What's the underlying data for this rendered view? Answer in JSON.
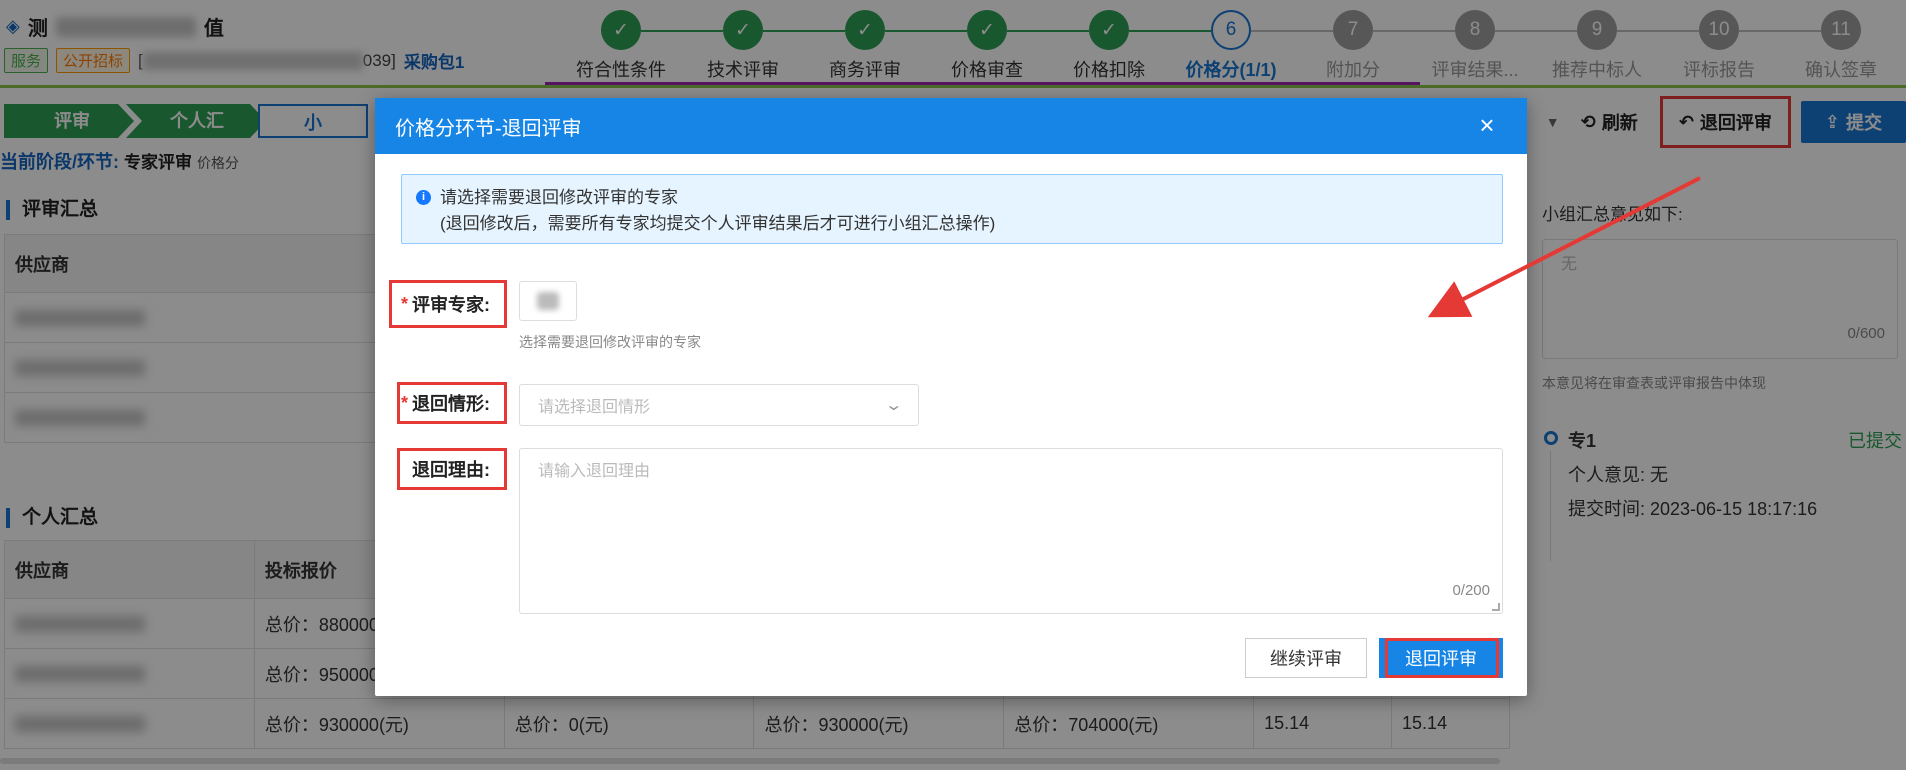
{
  "header": {
    "project_title_prefix": "测",
    "project_title_suffix": "值",
    "tag_service": "服务",
    "tag_method": "公开招标",
    "code_prefix": "[",
    "code_suffix": "039]",
    "package": "采购包1"
  },
  "steps": [
    {
      "num": "✓",
      "label": "符合性条件",
      "state": "done"
    },
    {
      "num": "✓",
      "label": "技术评审",
      "state": "done"
    },
    {
      "num": "✓",
      "label": "商务评审",
      "state": "done"
    },
    {
      "num": "✓",
      "label": "价格审查",
      "state": "done"
    },
    {
      "num": "✓",
      "label": "价格扣除",
      "state": "done"
    },
    {
      "num": "6",
      "label": "价格分(1/1)",
      "state": "current"
    },
    {
      "num": "7",
      "label": "附加分",
      "state": "todo"
    },
    {
      "num": "8",
      "label": "评审结果...",
      "state": "todo"
    },
    {
      "num": "9",
      "label": "推荐中标人",
      "state": "todo"
    },
    {
      "num": "10",
      "label": "评标报告",
      "state": "todo"
    },
    {
      "num": "11",
      "label": "确认签章",
      "state": "todo"
    }
  ],
  "breadcrumb": [
    "评审",
    "个人汇总",
    "小"
  ],
  "stage": {
    "label": "当前阶段/环节:",
    "value": "专家评审",
    "sub": "价格分"
  },
  "sections": {
    "summary": "评审汇总",
    "personal": "个人汇总"
  },
  "summary_table": {
    "header": "供应商"
  },
  "personal_table": {
    "headers": [
      "供应商",
      "投标报价"
    ],
    "rows": [
      [
        "总价：880000",
        "",
        "",
        "",
        "",
        ""
      ],
      [
        "总价：950000",
        "",
        "",
        "",
        "",
        ""
      ],
      [
        "总价：930000(元)",
        "总价：0(元)",
        "总价：930000(元)",
        "总价：704000(元)",
        "15.14",
        "15.14"
      ]
    ]
  },
  "toolbar": {
    "refresh": "刷新",
    "return": "退回评审",
    "submit": "提交"
  },
  "right_panel": {
    "opinion_label": "小组汇总意见如下:",
    "opinion_text": "无",
    "opinion_count": "0/600",
    "hint": "本意见将在审查表或评审报告中体现",
    "expert_name": "专1",
    "expert_status": "已提交",
    "personal_opinion": "个人意见:  无",
    "submit_time": "提交时间:  2023-06-15 18:17:16"
  },
  "dialog": {
    "title": "价格分环节-退回评审",
    "info_line1": "请选择需要退回修改评审的专家",
    "info_line2": "(退回修改后，需要所有专家均提交个人评审结果后才可进行小组汇总操作)",
    "expert_label": "评审专家:",
    "expert_hint": "选择需要退回修改评审的专家",
    "situation_label": "退回情形:",
    "situation_placeholder": "请选择退回情形",
    "reason_label": "退回理由:",
    "reason_placeholder": "请输入退回理由",
    "reason_count": "0/200",
    "btn_continue": "继续评审",
    "btn_return": "退回评审"
  },
  "colors": {
    "primary": "#1685e6",
    "success": "#2e9e54",
    "highlight": "#e53935"
  }
}
